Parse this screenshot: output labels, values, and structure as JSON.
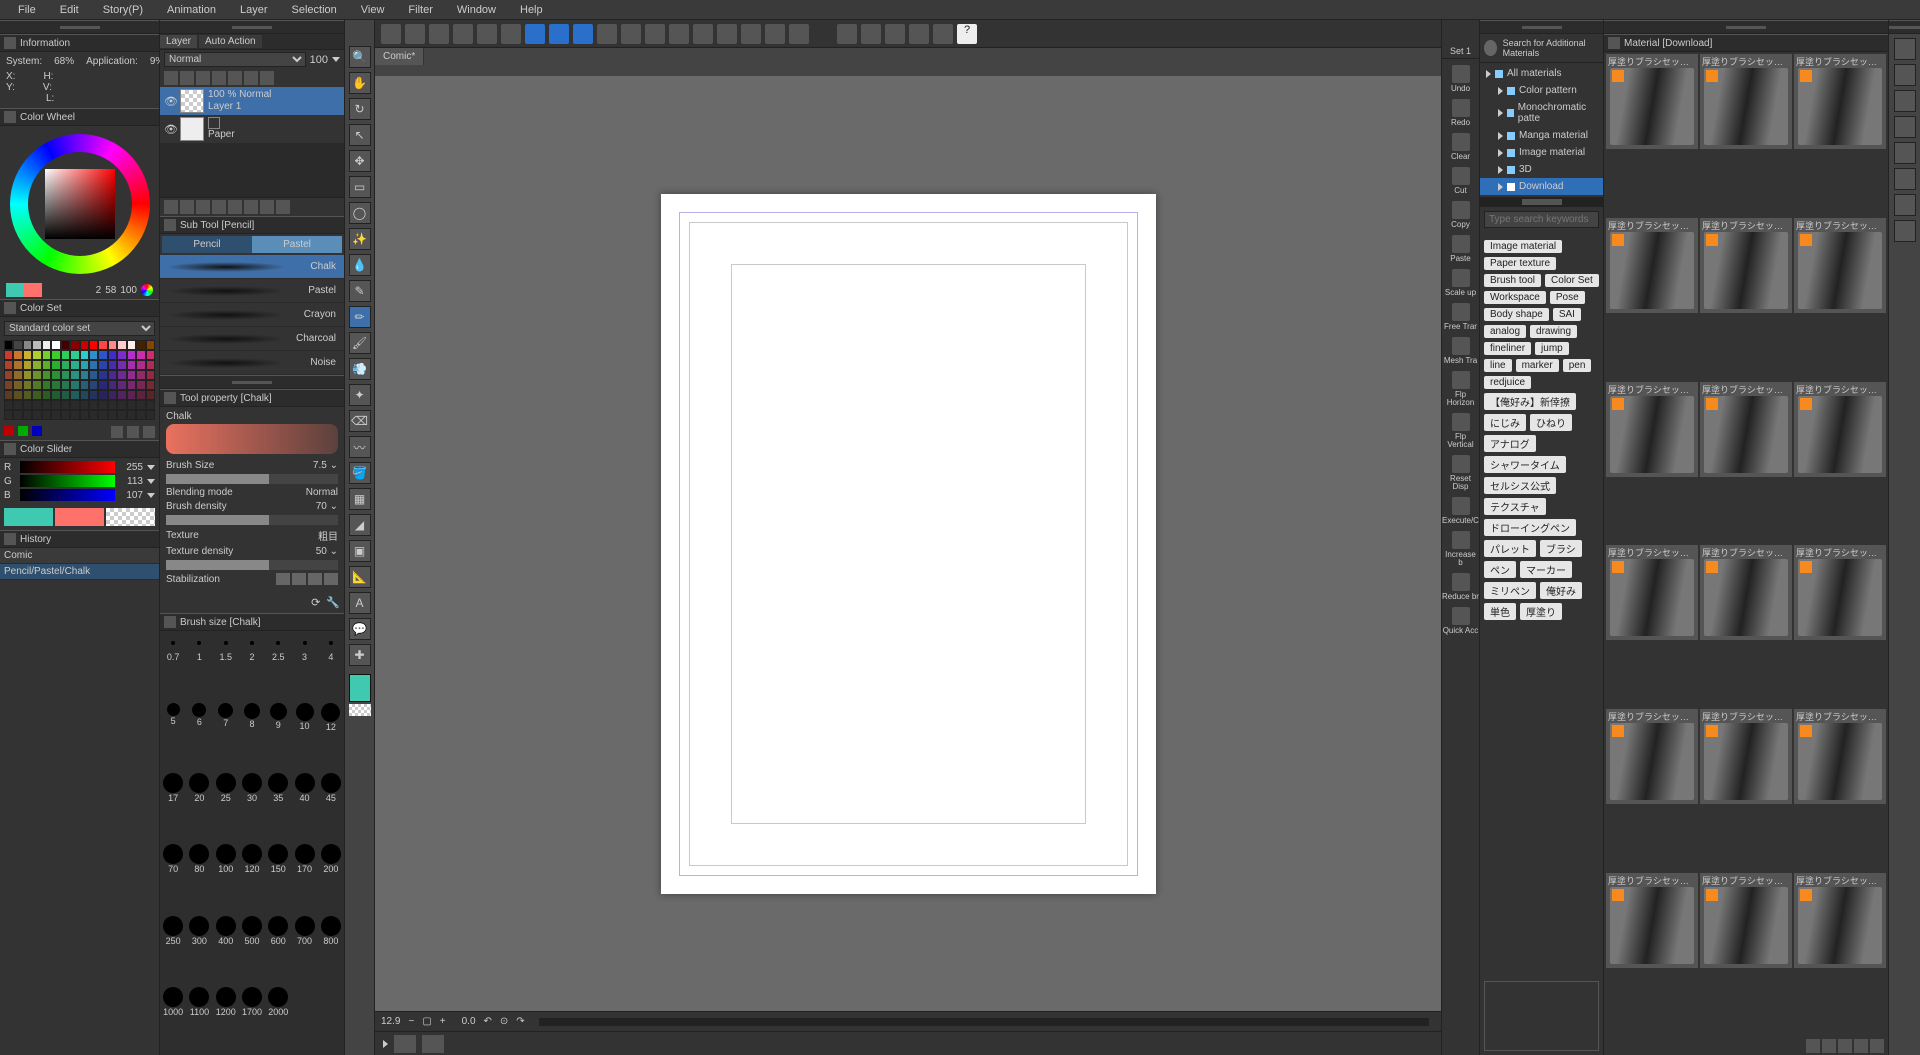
{
  "menu": [
    "File",
    "Edit",
    "Story(P)",
    "Animation",
    "Layer",
    "Selection",
    "View",
    "Filter",
    "Window",
    "Help"
  ],
  "info_panel": {
    "title": "Information",
    "system_pct": "68%",
    "app_pct": "9%",
    "x": "",
    "y": "",
    "h": "",
    "v": "",
    "l": ""
  },
  "color_wheel": {
    "title": "Color Wheel",
    "v1": "2",
    "v2": "58",
    "v3": "100"
  },
  "color_set": {
    "title": "Color Set",
    "preset": "Standard color set"
  },
  "color_slider": {
    "title": "Color Slider",
    "channels": [
      {
        "lbl": "R",
        "val": "255",
        "grad": "linear-gradient(to right,#000,#f00)"
      },
      {
        "lbl": "G",
        "val": "113",
        "grad": "linear-gradient(to right,#000,#0f0)"
      },
      {
        "lbl": "B",
        "val": "107",
        "grad": "linear-gradient(to right,#000,#00f)"
      }
    ]
  },
  "history": {
    "title": "History",
    "items": [
      "Comic",
      "Pencil/Pastel/Chalk"
    ]
  },
  "layer": {
    "tab_layer": "Layer",
    "tab_auto": "Auto Action",
    "blend": "Normal",
    "opacity": "100",
    "layers": [
      {
        "name": "Layer 1",
        "mode": "100 % Normal",
        "sel": true,
        "checker": true
      },
      {
        "name": "Paper",
        "mode": "",
        "sel": false,
        "checker": false
      }
    ]
  },
  "subtool": {
    "title": "Sub Tool [Pencil]",
    "tabs": [
      "Pencil",
      "Pastel"
    ],
    "brushes": [
      "Chalk",
      "Pastel",
      "Crayon",
      "Charcoal",
      "Noise"
    ]
  },
  "toolprop": {
    "title": "Tool property [Chalk]",
    "name": "Chalk",
    "brush_size": "Brush Size",
    "brush_size_val": "7.5",
    "blend": "Blending mode",
    "blend_val": "Normal",
    "density": "Brush density",
    "density_val": "70",
    "texture": "Texture",
    "texture_val": "粗目",
    "tdensity": "Texture density",
    "tdensity_val": "50",
    "stab": "Stabilization"
  },
  "brushsize": {
    "title": "Brush size [Chalk]",
    "sizes": [
      "0.7",
      "1",
      "1.5",
      "2",
      "2.5",
      "3",
      "4",
      "5",
      "6",
      "7",
      "8",
      "9",
      "10",
      "12",
      "17",
      "20",
      "25",
      "30",
      "35",
      "40",
      "45",
      "70",
      "80",
      "100",
      "120",
      "150",
      "170",
      "200",
      "250",
      "300",
      "400",
      "500",
      "600",
      "700",
      "800",
      "1000",
      "1100",
      "1200",
      "1700",
      "2000"
    ]
  },
  "doc_tab": "Comic*",
  "canvas_status": {
    "zoom": "12.9",
    "angle": "0.0"
  },
  "quick_access": {
    "set": "Set 1",
    "items": [
      "Undo",
      "Redo",
      "Clear",
      "Cut",
      "Copy",
      "Paste",
      "Scale up",
      "Free Trar",
      "Mesh Tra",
      "Flp Horizon",
      "Flp Vertical",
      "Reset Disp",
      "Execute/C",
      "Increase b",
      "Reduce br",
      "Quick Acc"
    ]
  },
  "material": {
    "panel": "Material [Download]",
    "search": "Search for Additional Materials",
    "tree": [
      {
        "label": "All materials",
        "indent": false,
        "sel": false
      },
      {
        "label": "Color pattern",
        "indent": true,
        "sel": false
      },
      {
        "label": "Monochromatic patte",
        "indent": true,
        "sel": false
      },
      {
        "label": "Manga material",
        "indent": true,
        "sel": false
      },
      {
        "label": "Image material",
        "indent": true,
        "sel": false
      },
      {
        "label": "3D",
        "indent": true,
        "sel": false
      },
      {
        "label": "Download",
        "indent": true,
        "sel": true
      }
    ],
    "tag_search_ph": "Type search keywords",
    "tags": [
      "Image material",
      "Paper texture",
      "Brush tool",
      "Color Set",
      "Workspace",
      "Pose",
      "Body shape",
      "SAI",
      "analog",
      "drawing",
      "fineliner",
      "jump",
      "line",
      "marker",
      "pen",
      "redjuice",
      "【俺好み】新倖撩",
      "にじみ",
      "ひねり",
      "アナログ",
      "シャワータイム",
      "セルシス公式",
      "テクスチャ",
      "ドローイングペン",
      "パレット",
      "ブラシ",
      "ペン",
      "マーカー",
      "ミリペン",
      "俺好み",
      "単色",
      "厚塗り"
    ],
    "items": [
      "厚塗りブラシセット-平筆滲ばし",
      "厚塗りブラシセット-塗料普通",
      "厚塗りブラシセット-塗料不足",
      "厚塗りブラシセット-塗料不足",
      "厚塗りブラシセット-不規則(",
      "厚塗りブラシセット-不規則(",
      "厚塗りブラシセット-不規則(",
      "厚塗りブラシセットランダム荒",
      "厚塗りブラシセット-モデリング",
      "厚塗りブラシセット-モデペ/",
      "厚塗りブラシセット-モデペパス",
      "厚塗りブラシセット-モデペパス",
      "厚塗りブラシセット-モデペ/",
      "厚塗りブラシセット-まだら平面",
      "厚塗りブラシセット-まだらパス",
      "厚塗りブラシセット-ぼつぼつ",
      "厚塗りブラシセット-ハイライト★",
      "厚塗りブラシセット-ハイライト■"
    ]
  }
}
